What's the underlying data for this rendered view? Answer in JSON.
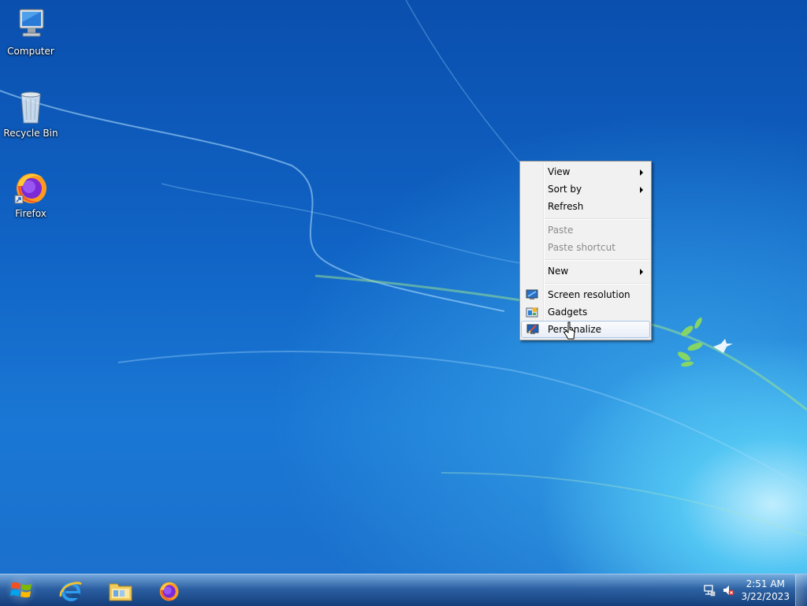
{
  "desktop": {
    "icons": [
      {
        "label": "Computer",
        "icon": "computer-icon"
      },
      {
        "label": "Recycle Bin",
        "icon": "recycle-bin-icon"
      },
      {
        "label": "Firefox",
        "icon": "firefox-icon"
      }
    ]
  },
  "context_menu": {
    "items": [
      {
        "label": "View",
        "submenu": true,
        "enabled": true
      },
      {
        "label": "Sort by",
        "submenu": true,
        "enabled": true
      },
      {
        "label": "Refresh",
        "submenu": false,
        "enabled": true
      },
      {
        "label": "Paste",
        "submenu": false,
        "enabled": false
      },
      {
        "label": "Paste shortcut",
        "submenu": false,
        "enabled": false
      },
      {
        "label": "New",
        "submenu": true,
        "enabled": true
      },
      {
        "label": "Screen resolution",
        "icon": "screen-resolution-icon",
        "enabled": true
      },
      {
        "label": "Gadgets",
        "icon": "gadgets-icon",
        "enabled": true
      },
      {
        "label": "Personalize",
        "icon": "personalize-icon",
        "enabled": true,
        "highlighted": true
      }
    ]
  },
  "taskbar": {
    "pinned": [
      {
        "name": "Internet Explorer",
        "icon": "internet-explorer-icon"
      },
      {
        "name": "Windows Explorer",
        "icon": "folder-icon"
      },
      {
        "name": "Firefox",
        "icon": "firefox-icon"
      }
    ],
    "tray": {
      "time": "2:51 AM",
      "date": "3/22/2023"
    }
  },
  "colors": {
    "desktop_base": "#1063c4",
    "menu_bg": "#f1f1f1",
    "menu_highlight_border": "#aac4e8"
  }
}
